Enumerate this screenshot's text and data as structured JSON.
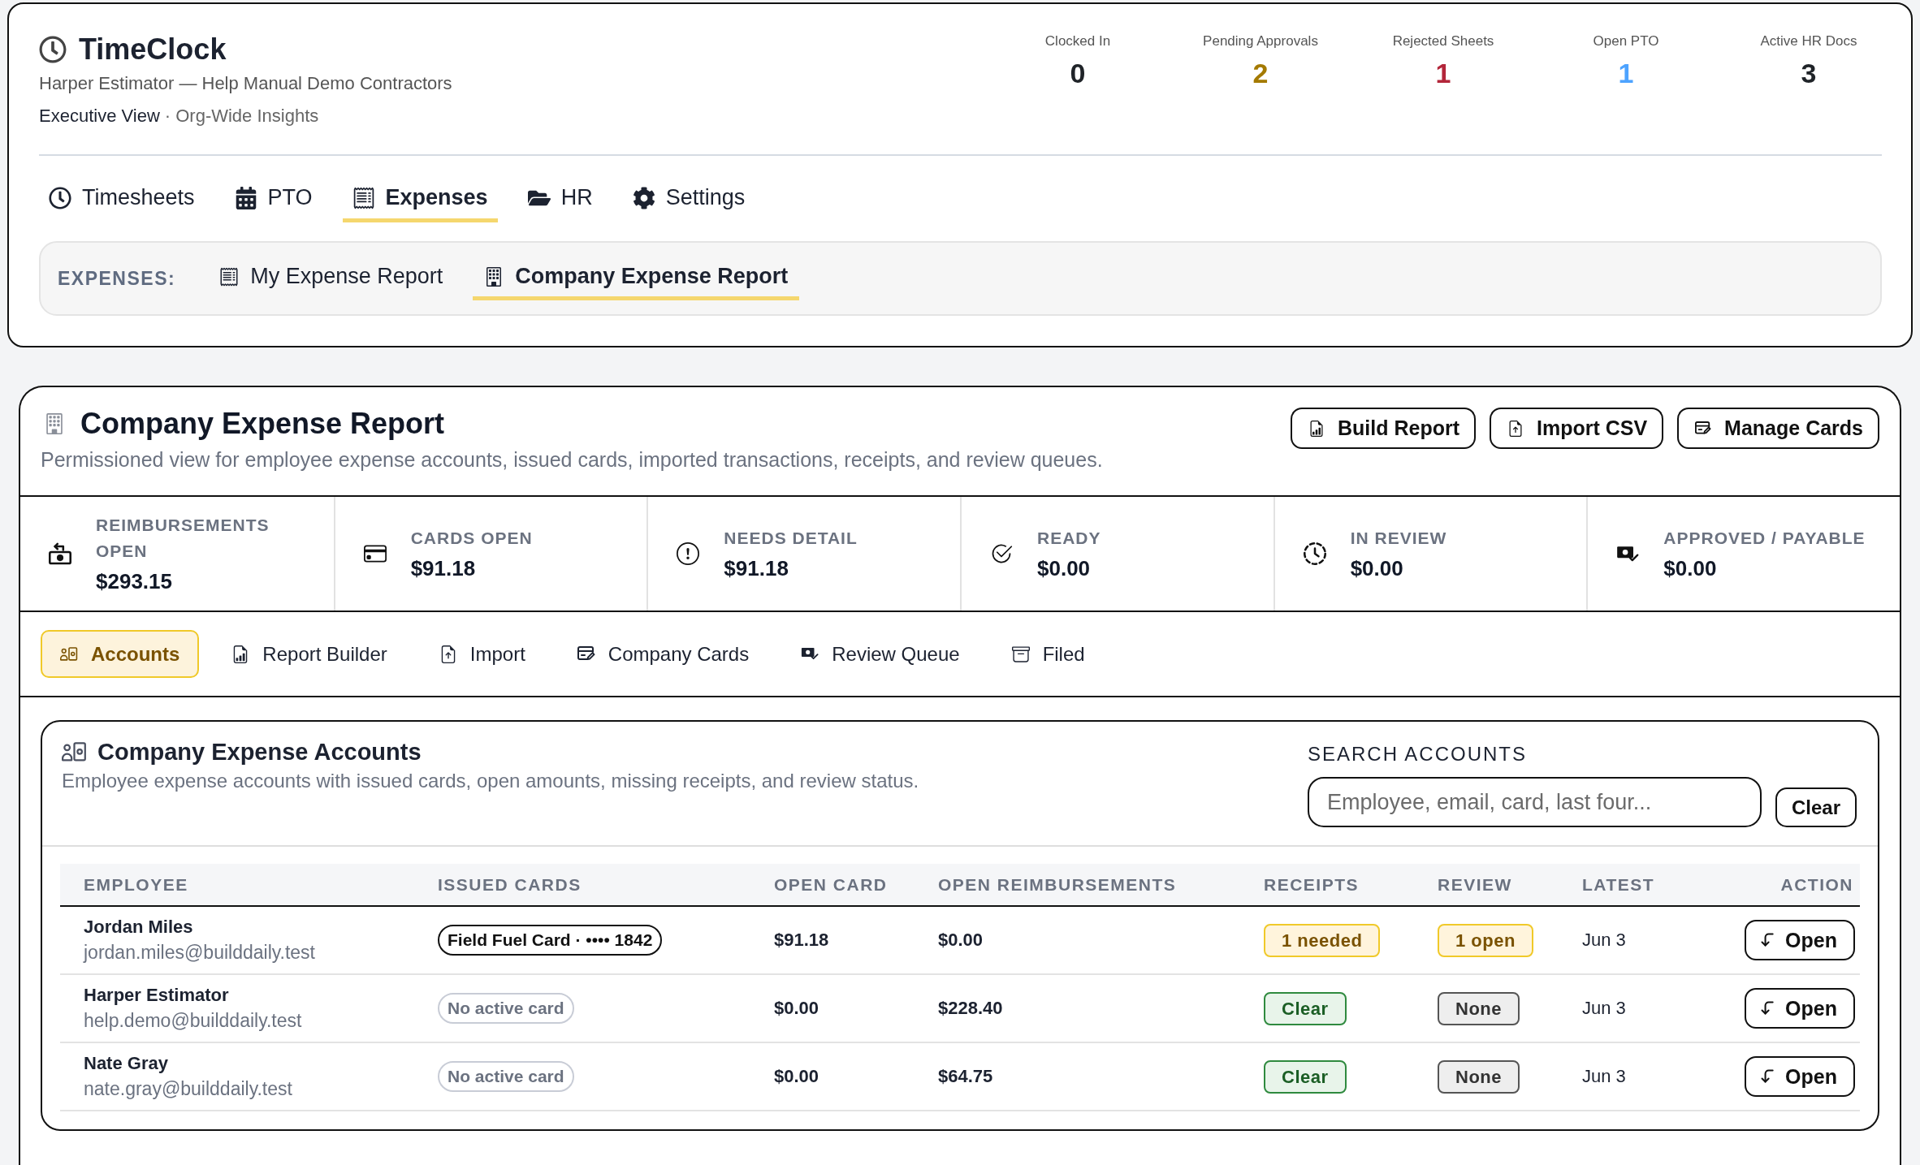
{
  "app": {
    "title": "TimeClock",
    "subtitle": "Harper Estimator — Help Manual Demo Contractors",
    "role": "Executive View",
    "scope": "· Org-Wide Insights"
  },
  "summary": [
    {
      "label": "Clocked In",
      "value": "0",
      "color": "#1f2328"
    },
    {
      "label": "Pending Approvals",
      "value": "2",
      "color": "#a47a00"
    },
    {
      "label": "Rejected Sheets",
      "value": "1",
      "color": "#b3263a"
    },
    {
      "label": "Open PTO",
      "value": "1",
      "color": "#4da3ff"
    },
    {
      "label": "Active HR Docs",
      "value": "3",
      "color": "#1f2328"
    }
  ],
  "nav_tabs": [
    {
      "label": "Timesheets",
      "selected": false
    },
    {
      "label": "PTO",
      "selected": false
    },
    {
      "label": "Expenses",
      "selected": true
    },
    {
      "label": "HR",
      "selected": false
    },
    {
      "label": "Settings",
      "selected": false
    }
  ],
  "subnav": {
    "label": "EXPENSES:",
    "items": [
      {
        "label": "My Expense Report",
        "selected": false
      },
      {
        "label": "Company Expense Report",
        "selected": true
      }
    ]
  },
  "report": {
    "title": "Company Expense Report",
    "description": "Permissioned view for employee expense accounts, issued cards, imported transactions, receipts, and review queues.",
    "actions": [
      "Build Report",
      "Import CSV",
      "Manage Cards"
    ]
  },
  "metrics": [
    {
      "label": "REIMBURSEMENTS OPEN",
      "value": "$293.15"
    },
    {
      "label": "CARDS OPEN",
      "value": "$91.18"
    },
    {
      "label": "NEEDS DETAIL",
      "value": "$91.18"
    },
    {
      "label": "READY",
      "value": "$0.00"
    },
    {
      "label": "IN REVIEW",
      "value": "$0.00"
    },
    {
      "label": "APPROVED / PAYABLE",
      "value": "$0.00"
    }
  ],
  "section_tabs": [
    {
      "label": "Accounts",
      "selected": true
    },
    {
      "label": "Report Builder",
      "selected": false
    },
    {
      "label": "Import",
      "selected": false
    },
    {
      "label": "Company Cards",
      "selected": false
    },
    {
      "label": "Review Queue",
      "selected": false
    },
    {
      "label": "Filed",
      "selected": false
    }
  ],
  "accounts": {
    "title": "Company Expense Accounts",
    "description": "Employee expense accounts with issued cards, open amounts, missing receipts, and review status.",
    "search": {
      "label": "SEARCH ACCOUNTS",
      "placeholder": "Employee, email, card, last four...",
      "clear_button": "Clear"
    },
    "table": {
      "columns": [
        "EMPLOYEE",
        "ISSUED CARDS",
        "OPEN CARD",
        "OPEN REIMBURSEMENTS",
        "RECEIPTS",
        "REVIEW",
        "LATEST",
        "ACTION"
      ],
      "rows": [
        {
          "name": "Jordan Miles",
          "email": "jordan.miles@builddaily.test",
          "issued_card": {
            "label": "Field Fuel Card · •••• 1842",
            "active": true
          },
          "open_card": "$91.18",
          "open_reimbursements": "$0.00",
          "receipts": {
            "label": "1 needed",
            "kind": "warning"
          },
          "review": {
            "label": "1 open",
            "kind": "warning"
          },
          "latest": "Jun 3",
          "action": "Open"
        },
        {
          "name": "Harper Estimator",
          "email": "help.demo@builddaily.test",
          "issued_card": {
            "label": "No active card",
            "active": false
          },
          "open_card": "$0.00",
          "open_reimbursements": "$228.40",
          "receipts": {
            "label": "Clear",
            "kind": "clear"
          },
          "review": {
            "label": "None",
            "kind": "none"
          },
          "latest": "Jun 3",
          "action": "Open"
        },
        {
          "name": "Nate Gray",
          "email": "nate.gray@builddaily.test",
          "issued_card": {
            "label": "No active card",
            "active": false
          },
          "open_card": "$0.00",
          "open_reimbursements": "$64.75",
          "receipts": {
            "label": "Clear",
            "kind": "clear"
          },
          "review": {
            "label": "None",
            "kind": "none"
          },
          "latest": "Jun 3",
          "action": "Open"
        }
      ]
    }
  }
}
